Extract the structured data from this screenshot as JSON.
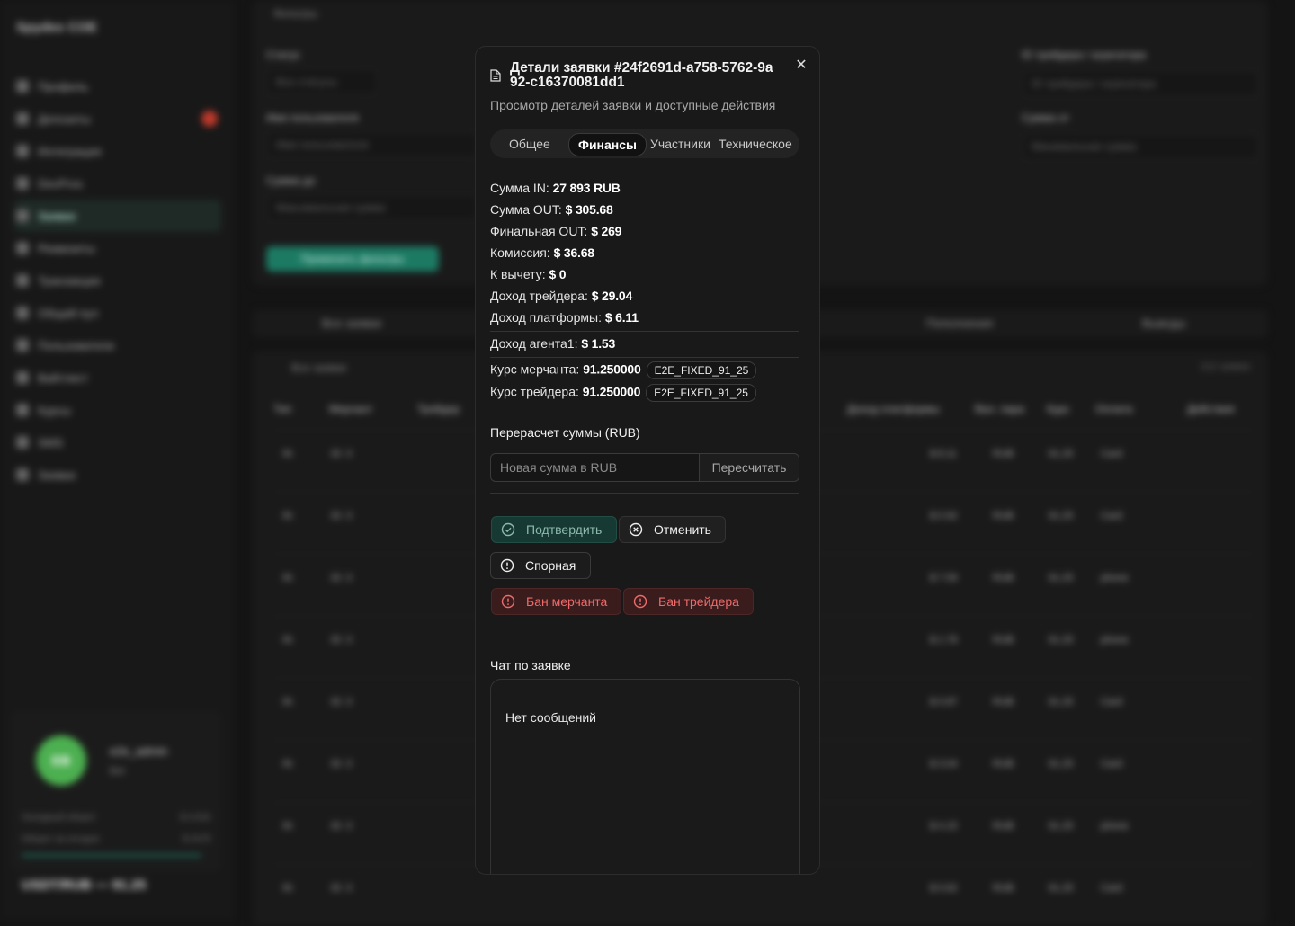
{
  "background": {
    "brand": "Spydex COE",
    "nav": [
      "Профиль",
      "Депозиты",
      "Интеграция",
      "DevPros",
      "Заявки",
      "Реквизиты",
      "Транзакции",
      "Общий пул",
      "Пользователи",
      "Вайтлист",
      "Курсы",
      "SMS",
      "Заявки"
    ],
    "user": {
      "avatar_initials": "ЕВ",
      "name": "e2e_admin",
      "role": "Bot",
      "stat1_label": "Холодный оборот",
      "stat1_value": "$ 4.61К",
      "stat2_label": "Оборот за сегодня",
      "stat2_value": "$ 2475"
    },
    "rate": "USDT/RUB — 91.25",
    "filters": {
      "title": "Фильтры",
      "status_label": "Статус",
      "status_value": "Все статусы",
      "username_label": "Имя пользователя",
      "username_placeholder": "Имя пользователя",
      "amount_to_label": "Сумма до",
      "amount_to_placeholder": "Максимальная сумма",
      "trader_id_label": "ID трейдера / агрегатора",
      "trader_id_placeholder": "ID трейдера / агрегатора",
      "amount_from_label": "Сумма от",
      "amount_from_placeholder": "Минимальная сумма",
      "apply": "Применить фильтры"
    },
    "tabs": [
      "Все заявки",
      "Пополнения",
      "Выводы"
    ],
    "table": {
      "title": "Все заявки",
      "count": "212 заявок",
      "headers": [
        "Тип",
        "Мерчант",
        "Трейдер",
        "Доход платформы",
        "Вал. пара",
        "Курс",
        "Оплата",
        "Действия"
      ],
      "rows": [
        {
          "type": "IN",
          "merchant": "ID: 3",
          "platform": "$ 8.11",
          "pair": "RUB",
          "rate": "91.25",
          "pay": "Card"
        },
        {
          "type": "IN",
          "merchant": "ID: 3",
          "platform": "$ 0.92",
          "pair": "RUB",
          "rate": "91.25",
          "pay": "Card"
        },
        {
          "type": "IN",
          "merchant": "ID: 3",
          "platform": "$ 7.59",
          "pair": "RUB",
          "rate": "91.25",
          "pay": "phone"
        },
        {
          "type": "IN",
          "merchant": "ID: 3",
          "platform": "$ 1.78",
          "pair": "RUB",
          "rate": "91.25",
          "pay": "phone"
        },
        {
          "type": "IN",
          "merchant": "ID: 3",
          "platform": "$ 0.87",
          "pair": "RUB",
          "rate": "91.25",
          "pay": "Card"
        },
        {
          "type": "IN",
          "merchant": "ID: 3",
          "platform": "$ 3.04",
          "pair": "RUB",
          "rate": "91.25",
          "pay": "Card"
        },
        {
          "type": "IN",
          "merchant": "ID: 3",
          "platform": "$ 4.15",
          "pair": "RUB",
          "rate": "91.25",
          "pay": "phone"
        },
        {
          "type": "IN",
          "merchant": "ID: 3",
          "platform": "$ 0.62",
          "pair": "RUB",
          "rate": "91.25",
          "pay": "Card"
        }
      ]
    }
  },
  "modal": {
    "title": "Детали заявки #24f2691d-a758-5762-9a92-c16370081dd1",
    "subtitle": "Просмотр деталей заявки и доступные действия",
    "tabs": [
      "Общее",
      "Финансы",
      "Участники",
      "Техническое"
    ],
    "active_tab": "Финансы",
    "finance": {
      "sum_in_label": "Сумма IN:",
      "sum_in_value": "27 893 RUB",
      "sum_out_label": "Сумма OUT:",
      "sum_out_value": "$ 305.68",
      "final_out_label": "Финальная OUT:",
      "final_out_value": "$ 269",
      "commission_label": "Комиссия:",
      "commission_value": "$ 36.68",
      "deduct_label": "К вычету:",
      "deduct_value": "$ 0",
      "trader_income_label": "Доход трейдера:",
      "trader_income_value": "$ 29.04",
      "platform_income_label": "Доход платформы:",
      "platform_income_value": "$ 6.11",
      "agent_income_label": "Доход агента1:",
      "agent_income_value": "$ 1.53",
      "merchant_rate_label": "Курс мерчанта:",
      "merchant_rate_value": "91.250000",
      "merchant_rate_tag": "E2E_FIXED_91_25",
      "trader_rate_label": "Курс трейдера:",
      "trader_rate_value": "91.250000",
      "trader_rate_tag": "E2E_FIXED_91_25"
    },
    "recalc": {
      "title": "Перерасчет суммы (RUB)",
      "input_placeholder": "Новая сумма в RUB",
      "input_value": "",
      "button": "Пересчитать"
    },
    "actions": {
      "confirm": "Подтвердить",
      "cancel": "Отменить",
      "dispute": "Спорная",
      "ban_merchant": "Бан мерчанта",
      "ban_trader": "Бан трейдера"
    },
    "chat": {
      "title": "Чат по заявке",
      "empty": "Нет сообщений"
    }
  },
  "colors": {
    "accent_green": "#1c7a63",
    "danger": "#ee6b6b",
    "modal_bg": "#191919"
  }
}
